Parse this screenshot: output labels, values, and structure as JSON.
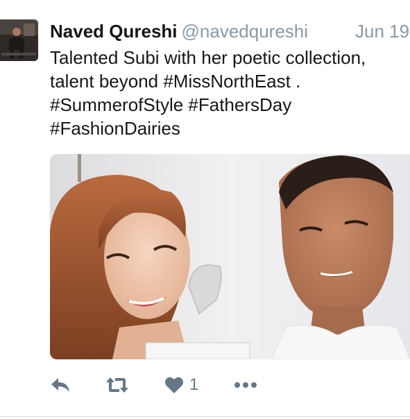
{
  "tweet": {
    "author": {
      "display_name": "Naved Qureshi",
      "handle": "@navedqureshi"
    },
    "timestamp": "Jun 19",
    "text_lines": [
      "Talented Subi with her poetic collection,",
      "talent beyond #MissNorthEast .",
      "#SummerofStyle #FathersDay",
      "#FashionDairies"
    ],
    "actions": {
      "reply_icon": "reply-icon",
      "retweet_icon": "retweet-icon",
      "like_icon": "heart-icon",
      "like_count": "1",
      "more_icon": "more-icon"
    }
  },
  "colors": {
    "text": "#14171a",
    "secondary": "#8899a6",
    "action": "#657786"
  }
}
